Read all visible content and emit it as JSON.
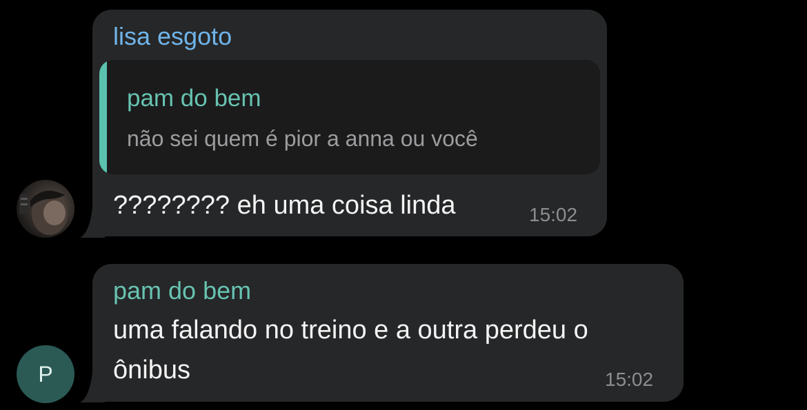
{
  "messages": [
    {
      "sender": "lisa esgoto",
      "reply": {
        "sender": "pam do bem",
        "text": "não sei quem é pior a anna ou você"
      },
      "text": "???????? eh uma coisa linda",
      "time": "15:02"
    },
    {
      "sender": "pam do bem",
      "avatar_initial": "P",
      "text": "uma falando no treino e a outra perdeu o ônibus",
      "time": "15:02"
    }
  ],
  "colors": {
    "background": "#000000",
    "bubble": "#262728",
    "reply_background": "#1b1b1c",
    "reply_bar": "#5bc2ae",
    "sender_lisa": "#6fb4ea",
    "sender_pam": "#67c3b1",
    "avatar_p": "#2b5a55"
  }
}
